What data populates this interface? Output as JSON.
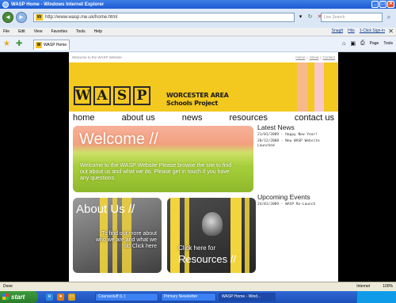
{
  "window": {
    "title": "WASP Home - Windows Internet Explorer",
    "buttons": [
      "_",
      "□",
      "✕"
    ]
  },
  "address": {
    "url": "http://www.wasp.me.uk/home.html",
    "search_placeholder": "Live Search"
  },
  "menubar": {
    "items": [
      "File",
      "Edit",
      "View",
      "Favorites",
      "Tools",
      "Help"
    ],
    "links": [
      "SnagIt",
      "Hits",
      "1-Click Sign-in"
    ]
  },
  "tab": {
    "label": "WASP Home"
  },
  "commandbar": {
    "page": "Page",
    "tools": "Tools"
  },
  "site": {
    "top_text": "Welcome to the WASP Website",
    "top_links": [
      "Home",
      "|",
      "About",
      "|",
      "Contact"
    ],
    "logo_letters": [
      "W",
      "A",
      "S",
      "P"
    ],
    "banner_title_line1": "WORCESTER AREA",
    "banner_title_line2": "Schools Project",
    "nav": [
      "home",
      "about us",
      "news",
      "resources",
      "contact us"
    ],
    "welcome": {
      "title": "Welcome //",
      "body": "Welcome to the WASP Website Please browse the site to find out about us and what we do. Please get in touch if you have any questions."
    },
    "about_card": {
      "title": "About Us //",
      "text": "To find out more about who we are and what we do Click here"
    },
    "resources_card": {
      "text": "Click here for",
      "title": "Resources //"
    },
    "latest_news": {
      "heading": "Latest News",
      "items": [
        "21/01/2009 - Happy New Year!",
        "20/12/2008 - New WASP Website Launched"
      ]
    },
    "upcoming_events": {
      "heading": "Upcoming Events",
      "items": [
        "24/01/2009 - WASP Re-Launch"
      ]
    }
  },
  "statusbar": {
    "left": "Done",
    "zone": "Internet",
    "zoom": "100%"
  },
  "taskbar": {
    "start": "start",
    "tasks": [
      "Coursestuff (L:)",
      "Primary Newsletter",
      "WASP Home - Wind..."
    ],
    "clock": ""
  },
  "colors": {
    "banner": "#f3c81f",
    "titlebar": "#1d5ad4",
    "welcome_top": "#f2a07e",
    "welcome_bottom": "#8fb92c"
  }
}
